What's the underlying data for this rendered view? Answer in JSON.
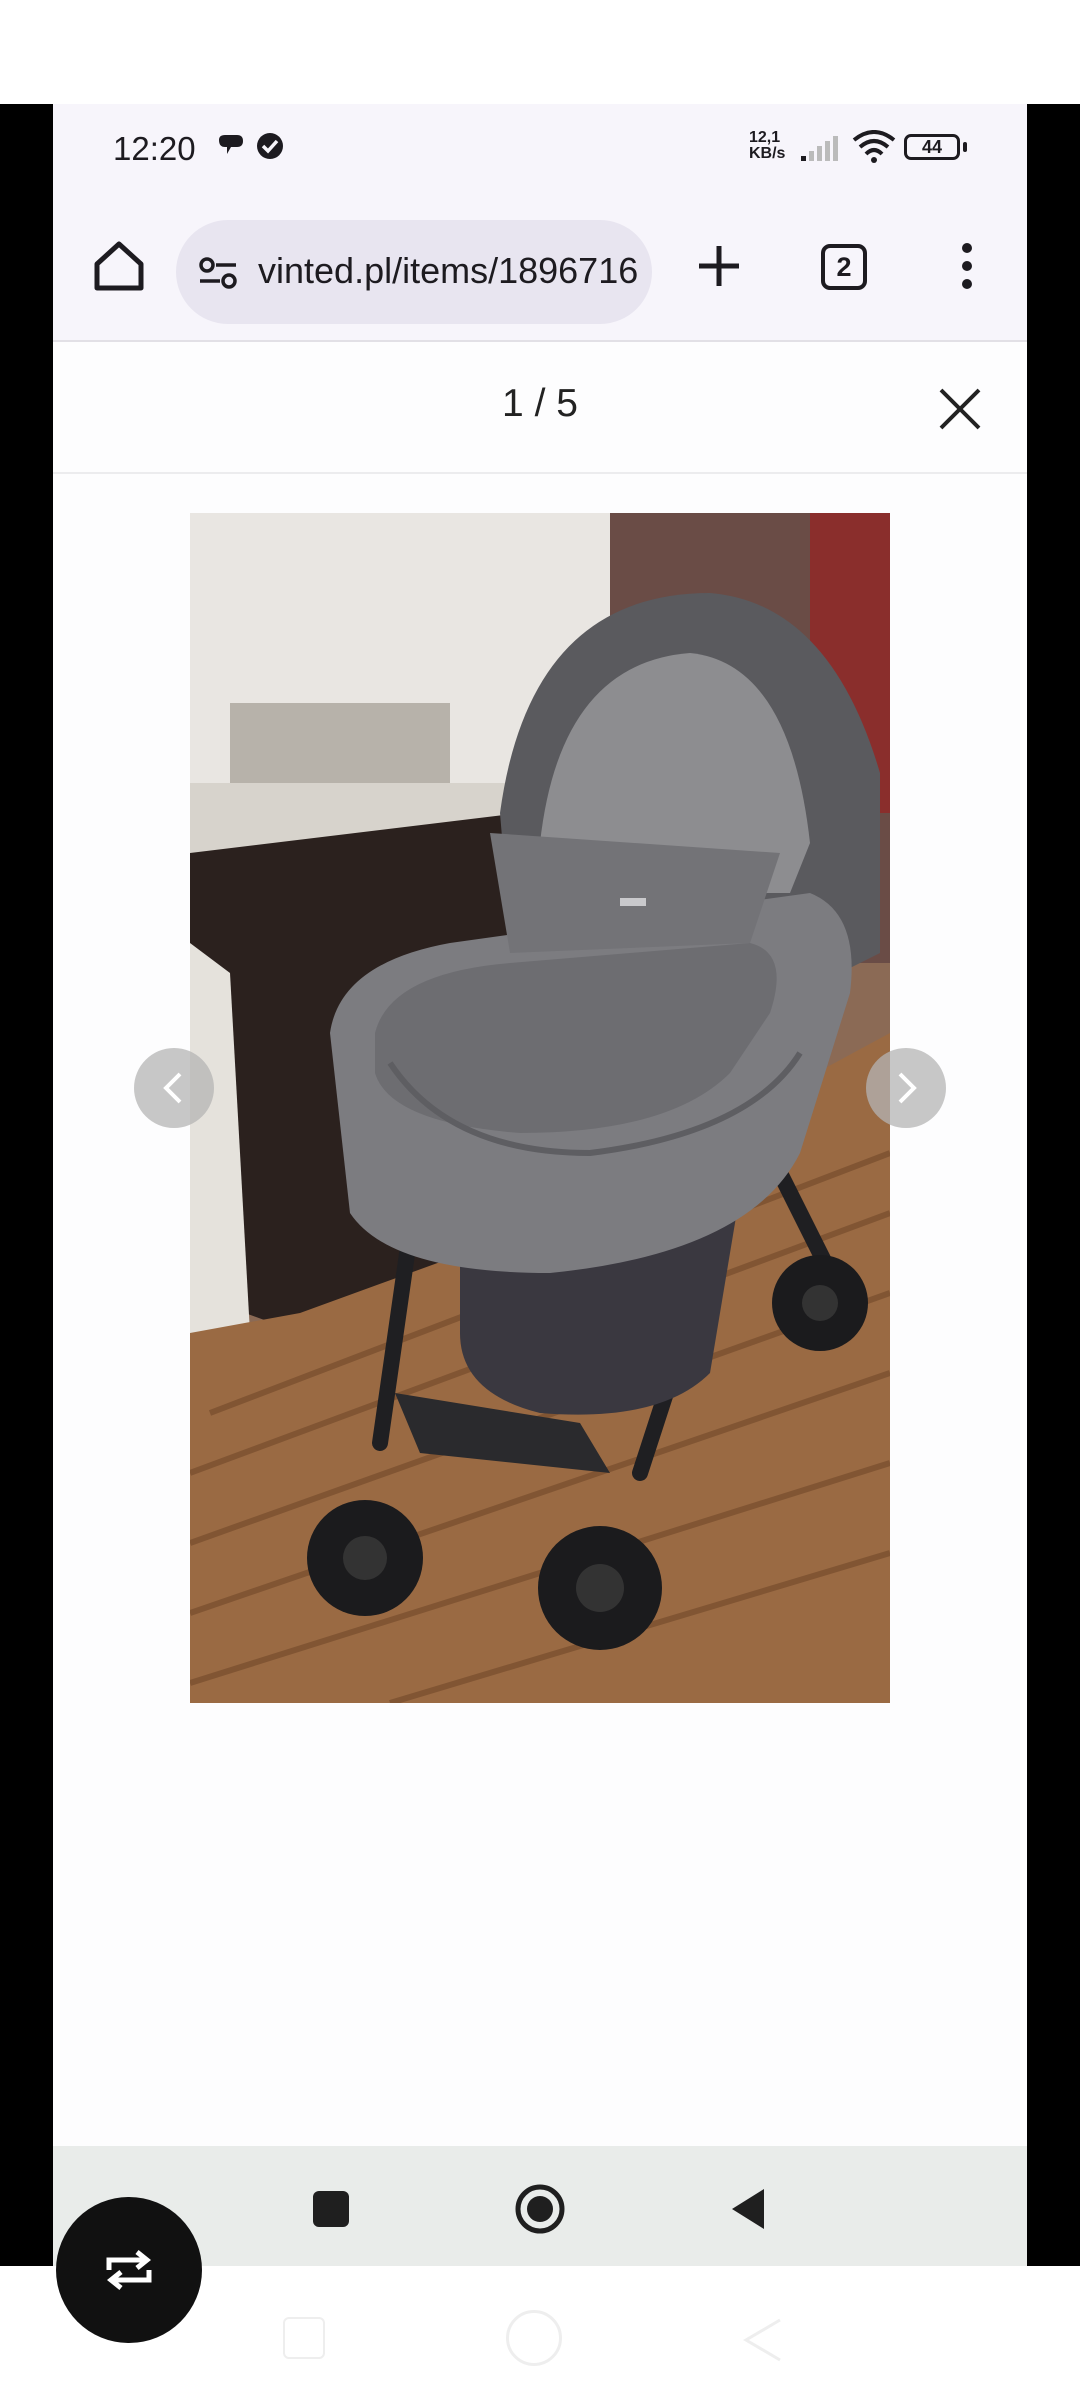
{
  "status_bar": {
    "time": "12:20",
    "net_speed_value": "12,1",
    "net_speed_unit": "KB/s",
    "battery": "44"
  },
  "browser": {
    "url": "vinted.pl/items/1896716",
    "tab_count": "2"
  },
  "gallery": {
    "counter": "1 / 5"
  },
  "icons": {
    "home": "home-icon",
    "site_settings": "tune-icon",
    "new_tab": "plus-icon",
    "tabs": "tab-switcher-icon",
    "menu": "more-vert-icon",
    "close": "close-icon",
    "prev": "chevron-left-icon",
    "next": "chevron-right-icon",
    "rotate": "screen-rotate-icon"
  },
  "colors": {
    "status_bg": "#f7f5fb",
    "url_pill_bg": "#e8e5f0",
    "nav_bg": "#e9ecea"
  }
}
